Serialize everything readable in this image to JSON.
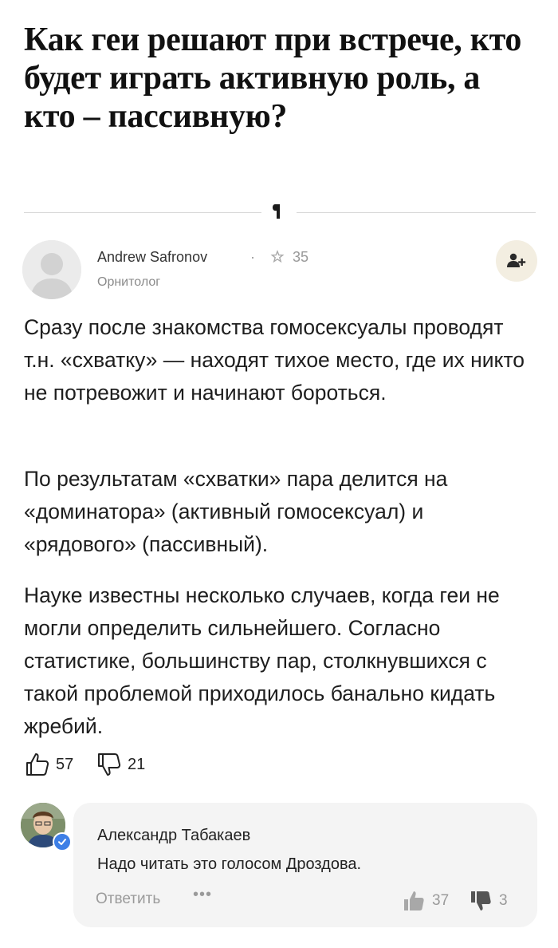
{
  "question": {
    "title": "Как геи решают при встрече, кто будет играть активную роль, а кто – пассивную?"
  },
  "author": {
    "name": "Andrew Safronov",
    "separator": "·",
    "rating": "35",
    "role": "Орнитолог"
  },
  "answer": {
    "paragraphs": [
      "Сразу после знакомства гомосексуалы проводят т.н. «схватку» — находят тихое место, где их никто не потревожит и начинают бороться.",
      "По результатам «схватки» пара делится на «доминатора» (активный гомосексуал) и «рядового» (пассивный).",
      "Науке известны несколько случаев, когда геи не могли определить сильнейшего. Согласно статистике, большинству пар, столкнувшихся с такой проблемой приходилось банально кидать жребий."
    ],
    "likes": "57",
    "dislikes": "21"
  },
  "comment": {
    "author": "Александр Табакаев",
    "text": "Надо читать это голосом Дроздова.",
    "reply_label": "Ответить",
    "more_label": "•••",
    "likes": "37",
    "dislikes": "3"
  },
  "colors": {
    "follow_bg": "#f3eee1",
    "verified": "#3d7fe6",
    "comment_bg": "#f4f4f4"
  }
}
